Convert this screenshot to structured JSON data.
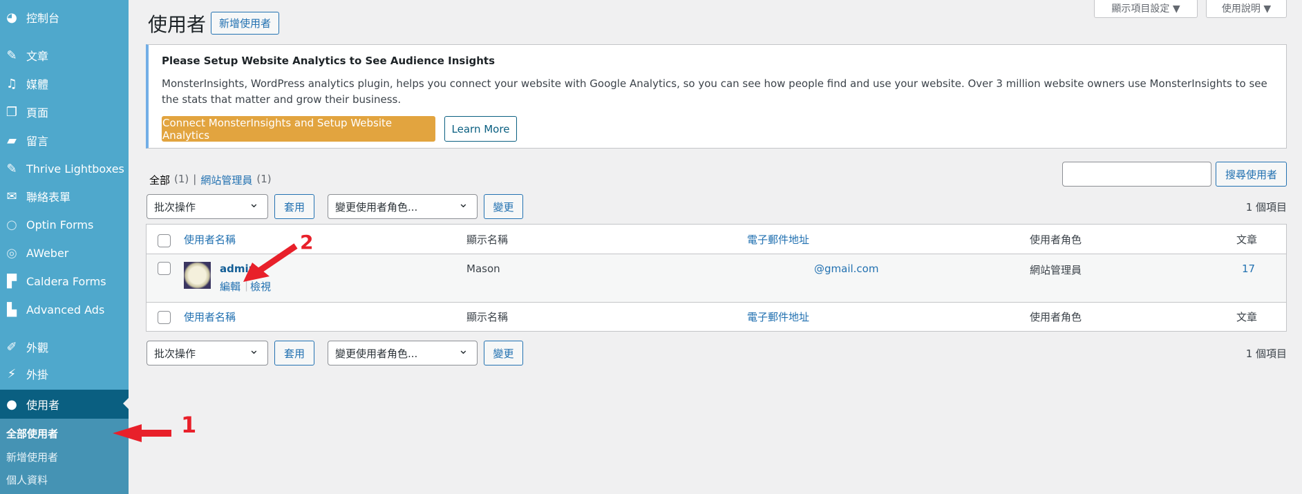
{
  "sidebar": {
    "items": [
      {
        "label": "控制台",
        "icon": "dashboard-icon"
      },
      {
        "label": "文章",
        "icon": "pin-icon"
      },
      {
        "label": "媒體",
        "icon": "media-icon"
      },
      {
        "label": "頁面",
        "icon": "pages-icon"
      },
      {
        "label": "留言",
        "icon": "comment-icon"
      },
      {
        "label": "Thrive Lightboxes",
        "icon": "pin-icon"
      },
      {
        "label": "聯絡表單",
        "icon": "mail-icon"
      },
      {
        "label": "Optin Forms",
        "icon": "circle-icon"
      },
      {
        "label": "AWeber",
        "icon": "aweber-icon"
      },
      {
        "label": "Caldera Forms",
        "icon": "caldera-icon"
      },
      {
        "label": "Advanced Ads",
        "icon": "ads-icon"
      },
      {
        "label": "外觀",
        "icon": "brush-icon"
      },
      {
        "label": "外掛",
        "icon": "plugin-icon"
      },
      {
        "label": "使用者",
        "icon": "user-icon"
      }
    ],
    "submenu": [
      "全部使用者",
      "新增使用者",
      "個人資料"
    ]
  },
  "header": {
    "title": "使用者",
    "add_new": "新增使用者",
    "screen_options": "顯示項目設定 ▼",
    "help": "使用說明 ▼"
  },
  "notice": {
    "title": "Please Setup Website Analytics to See Audience Insights",
    "text": "MonsterInsights, WordPress analytics plugin, helps you connect your website with Google Analytics, so you can see how people find and use your website. Over 3 million website owners use MonsterInsights to see the stats that matter and grow their business.",
    "connect": "Connect MonsterInsights and Setup Website Analytics",
    "learn_more": "Learn More",
    "accent": "#e2a43f"
  },
  "filters": {
    "all": "全部",
    "all_count": "(1)",
    "sep": "|",
    "admin": "網站管理員",
    "admin_count": "(1)"
  },
  "search": {
    "value": "",
    "button": "搜尋使用者"
  },
  "bulk": {
    "select": "批次操作",
    "apply": "套用",
    "role_select": "變更使用者角色...",
    "change": "變更",
    "count": "1 個項目"
  },
  "table": {
    "columns": [
      "使用者名稱",
      "顯示名稱",
      "電子郵件地址",
      "使用者角色",
      "文章"
    ],
    "rows": [
      {
        "username": "admin",
        "edit": "編輯",
        "view": "檢視",
        "display_name": "Mason",
        "email": "@gmail.com",
        "role": "網站管理員",
        "posts": "17"
      }
    ]
  },
  "annotations": {
    "one": "1",
    "two": "2",
    "color": "#e8202a"
  }
}
